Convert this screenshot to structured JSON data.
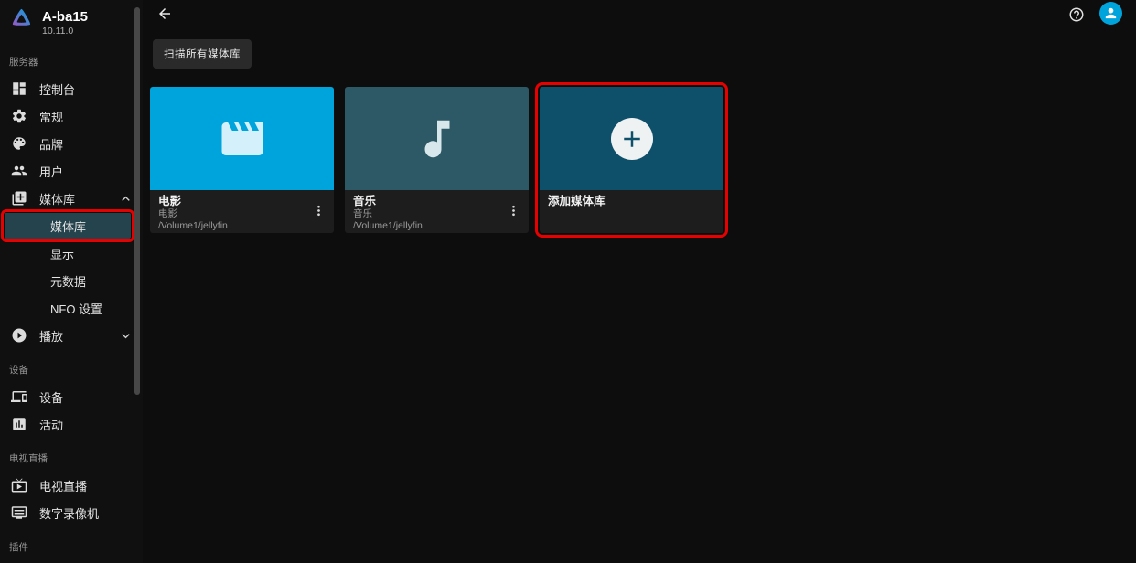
{
  "app": {
    "server_name": "A-ba15",
    "version": "10.11.0"
  },
  "sidebar": {
    "sections": [
      {
        "label": "服务器",
        "items": [
          {
            "label": "控制台",
            "icon": "dashboard-icon"
          },
          {
            "label": "常规",
            "icon": "settings-gear-icon"
          },
          {
            "label": "品牌",
            "icon": "palette-icon"
          },
          {
            "label": "用户",
            "icon": "users-icon"
          },
          {
            "label": "媒体库",
            "icon": "library-add-icon",
            "expanded": true,
            "children": [
              {
                "label": "媒体库",
                "selected": true,
                "annotated": true
              },
              {
                "label": "显示"
              },
              {
                "label": "元数据"
              },
              {
                "label": "NFO 设置"
              }
            ]
          },
          {
            "label": "播放",
            "icon": "playback-icon",
            "expanded": false
          }
        ]
      },
      {
        "label": "设备",
        "items": [
          {
            "label": "设备",
            "icon": "devices-icon"
          },
          {
            "label": "活动",
            "icon": "activity-chart-icon"
          }
        ]
      },
      {
        "label": "电视直播",
        "items": [
          {
            "label": "电视直播",
            "icon": "live-tv-icon"
          },
          {
            "label": "数字录像机",
            "icon": "dvr-icon"
          }
        ]
      },
      {
        "label": "插件",
        "items": []
      }
    ]
  },
  "main": {
    "scan_button_label": "扫描所有媒体库",
    "cards": [
      {
        "title": "电影",
        "subtitle": "电影",
        "path": "/Volume1/jellyfin",
        "icon": "movie-icon",
        "color": "#00a4dc"
      },
      {
        "title": "音乐",
        "subtitle": "音乐",
        "path": "/Volume1/jellyfin",
        "icon": "music-note-icon",
        "color": "#2d5866"
      },
      {
        "title": "添加媒体库",
        "icon": "add-plus-icon",
        "color": "#0e4f6a",
        "annotated": true
      }
    ]
  },
  "annotations": {
    "highlight_color": "#e60000",
    "targets": [
      "sidebar-subitem-libraries",
      "add-library-card"
    ]
  },
  "colors": {
    "accent": "#00a4dc",
    "background": "#0d0d0d",
    "sidebar_bg": "#101010",
    "card_info_bg": "#1d1d1d",
    "button_bg": "#2a2a2a",
    "selected_item_bg": "#25434c"
  }
}
